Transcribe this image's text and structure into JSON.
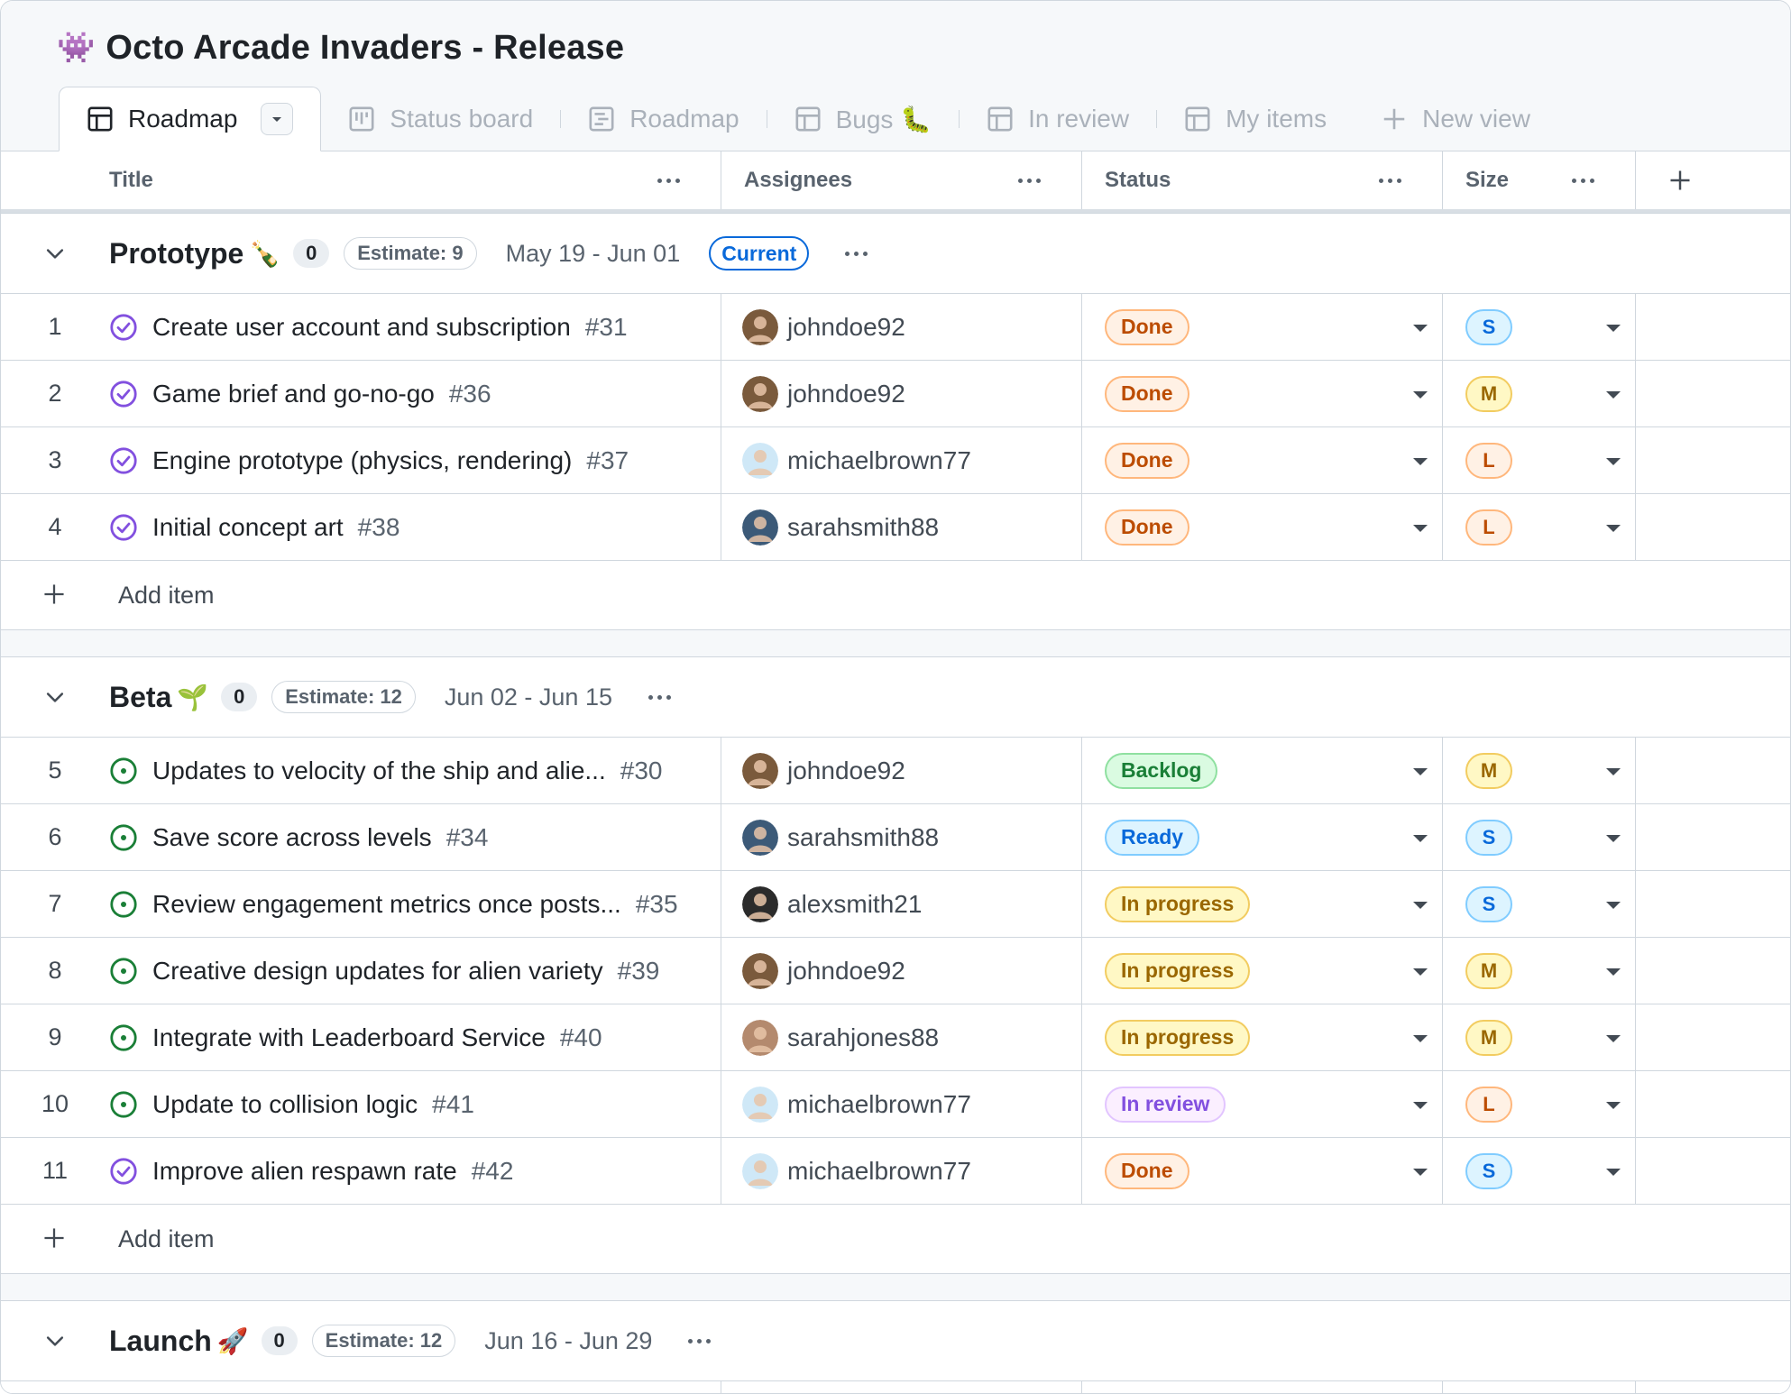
{
  "project": {
    "emoji": "👾",
    "title": "Octo Arcade Invaders - Release"
  },
  "tabs": [
    {
      "label": "Roadmap",
      "icon": "table-icon",
      "active": true
    },
    {
      "label": "Status board",
      "icon": "board-icon"
    },
    {
      "label": "Roadmap",
      "icon": "roadmap-icon"
    },
    {
      "label": "Bugs 🐛",
      "icon": "table-icon"
    },
    {
      "label": "In review",
      "icon": "table-icon"
    },
    {
      "label": "My items",
      "icon": "table-icon"
    },
    {
      "label": "New view",
      "icon": "plus-icon"
    }
  ],
  "columns": {
    "title": "Title",
    "assignees": "Assignees",
    "status": "Status",
    "size": "Size"
  },
  "add_item_label": "Add item",
  "groups": [
    {
      "name": "Prototype",
      "emoji": "🍾",
      "count": "0",
      "estimate": "Estimate: 9",
      "dates": "May 19 - Jun 01",
      "current": "Current",
      "rows": [
        {
          "num": "1",
          "title": "Create user account and subscription",
          "issue": "#31",
          "state": "closed",
          "assignee": "johndoe92",
          "status": "Done",
          "size": "S"
        },
        {
          "num": "2",
          "title": "Game brief and go-no-go",
          "issue": "#36",
          "state": "closed",
          "assignee": "johndoe92",
          "status": "Done",
          "size": "M"
        },
        {
          "num": "3",
          "title": "Engine prototype (physics, rendering)",
          "issue": "#37",
          "state": "closed",
          "assignee": "michaelbrown77",
          "status": "Done",
          "size": "L"
        },
        {
          "num": "4",
          "title": "Initial concept art",
          "issue": "#38",
          "state": "closed",
          "assignee": "sarahsmith88",
          "status": "Done",
          "size": "L"
        }
      ]
    },
    {
      "name": "Beta",
      "emoji": "🌱",
      "count": "0",
      "estimate": "Estimate: 12",
      "dates": "Jun 02 - Jun 15",
      "rows": [
        {
          "num": "5",
          "title": "Updates to velocity of the ship and alie...",
          "issue": "#30",
          "state": "open",
          "assignee": "johndoe92",
          "status": "Backlog",
          "size": "M"
        },
        {
          "num": "6",
          "title": "Save score across levels",
          "issue": "#34",
          "state": "open",
          "assignee": "sarahsmith88",
          "status": "Ready",
          "size": "S"
        },
        {
          "num": "7",
          "title": "Review engagement metrics once posts...",
          "issue": "#35",
          "state": "open",
          "assignee": "alexsmith21",
          "status": "In progress",
          "size": "S"
        },
        {
          "num": "8",
          "title": "Creative design updates for alien variety",
          "issue": "#39",
          "state": "open",
          "assignee": "johndoe92",
          "status": "In progress",
          "size": "M"
        },
        {
          "num": "9",
          "title": "Integrate with Leaderboard Service",
          "issue": "#40",
          "state": "open",
          "assignee": "sarahjones88",
          "status": "In progress",
          "size": "M"
        },
        {
          "num": "10",
          "title": "Update to collision logic",
          "issue": "#41",
          "state": "open",
          "assignee": "michaelbrown77",
          "status": "In review",
          "size": "L"
        },
        {
          "num": "11",
          "title": "Improve alien respawn rate",
          "issue": "#42",
          "state": "closed",
          "assignee": "michaelbrown77",
          "status": "Done",
          "size": "S"
        }
      ]
    },
    {
      "name": "Launch",
      "emoji": "🚀",
      "count": "0",
      "estimate": "Estimate: 12",
      "dates": "Jun 16 - Jun 29",
      "rows": []
    }
  ],
  "colors": {
    "open_state": "#1a7f37",
    "closed_state": "#8250df",
    "avatars": {
      "johndoe92": "#7a5a3c",
      "michaelbrown77": "#cfe8f7",
      "sarahsmith88": "#3c5a78",
      "alexsmith21": "#2b2b2b",
      "sarahjones88": "#b48a6e"
    }
  }
}
